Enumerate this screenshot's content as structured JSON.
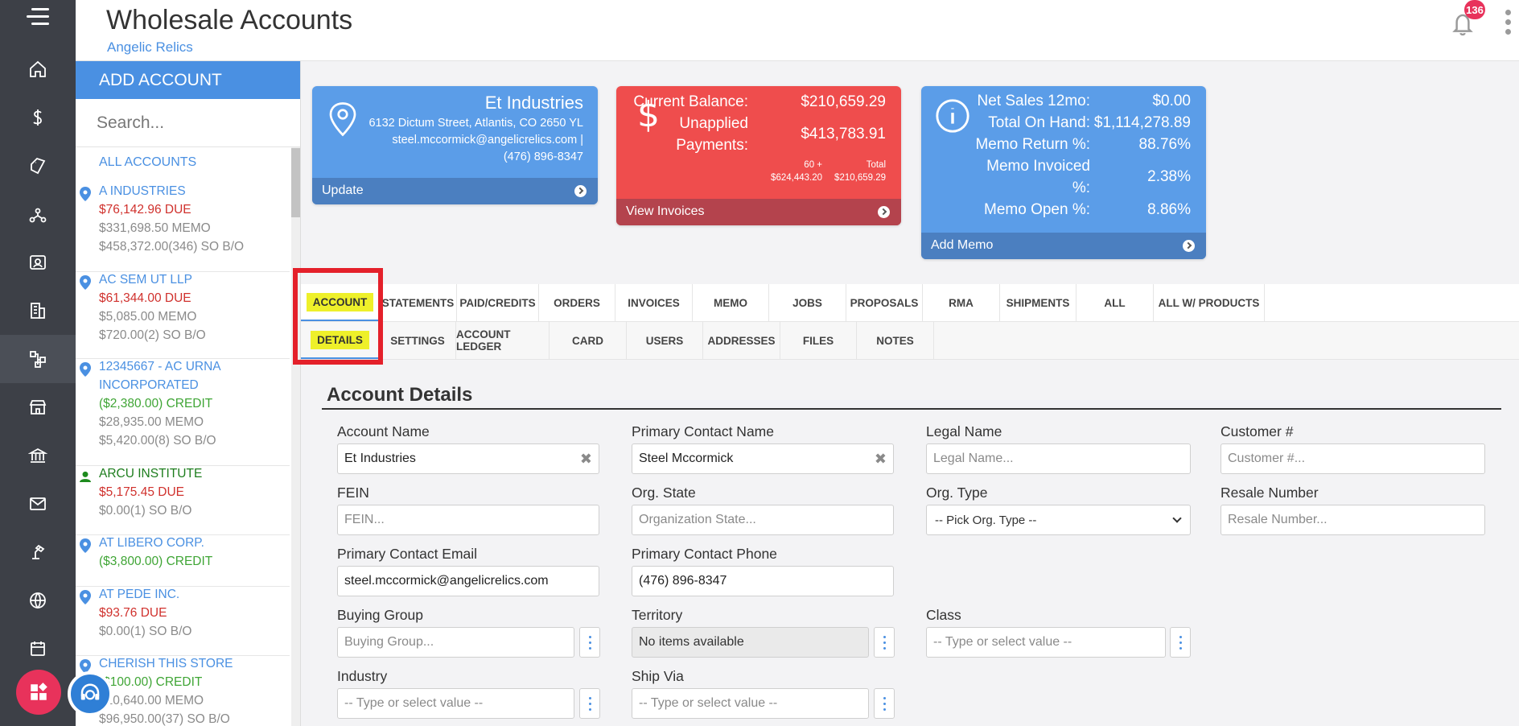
{
  "header": {
    "title": "Wholesale Accounts",
    "subtitle": "Angelic Relics",
    "notification_count": "136"
  },
  "rail": {
    "items": [
      "home-icon",
      "dollar-icon",
      "tags-icon",
      "network-icon",
      "contact-card-icon",
      "building-icon",
      "workflow-icon",
      "store-icon",
      "bank-icon",
      "mail-icon",
      "lamp-icon",
      "globe-icon",
      "calendar-icon"
    ]
  },
  "sidebar": {
    "add_label": "ADD ACCOUNT",
    "search_placeholder": "Search...",
    "all_label": "ALL ACCOUNTS",
    "accounts": [
      {
        "name": "A INDUSTRIES",
        "lines": [
          "$76,142.96 DUE",
          "$331,698.50 MEMO",
          "$458,372.00(346) SO B/O"
        ]
      },
      {
        "name": "AC SEM UT LLP",
        "lines": [
          "$61,344.00 DUE",
          "$5,085.00 MEMO",
          "$720.00(2) SO B/O"
        ]
      },
      {
        "name": "12345667 - AC URNA",
        "name2": "INCORPORATED",
        "lines": [
          "($2,380.00) CREDIT",
          "$28,935.00 MEMO",
          "$5,420.00(8) SO B/O"
        ]
      },
      {
        "name": "ARCU INSTITUTE",
        "lines": [
          "$5,175.45 DUE",
          "$0.00(1) SO B/O"
        ]
      },
      {
        "name": "AT LIBERO CORP.",
        "lines": [
          "($3,800.00) CREDIT"
        ]
      },
      {
        "name": "AT PEDE INC.",
        "lines": [
          "$93.76 DUE",
          "$0.00(1) SO B/O"
        ]
      },
      {
        "name": "CHERISH THIS STORE",
        "lines": [
          "($100.00) CREDIT",
          "$10,640.00 MEMO",
          "$96,950.00(37) SO B/O"
        ]
      }
    ]
  },
  "cards": {
    "company": {
      "name": "Et Industries",
      "address": "6132 Dictum Street, Atlantis, CO 2650 YL",
      "email": "steel.mccormick@angelicrelics.com |",
      "phone": "(476) 896-8347",
      "footer": "Update"
    },
    "balance": {
      "current_label": "Current Balance:",
      "current_value": "$210,659.29",
      "unapplied_label1": "Unapplied",
      "unapplied_label2": "Payments:",
      "unapplied_value": "$413,783.91",
      "aging_label": "60 +",
      "aging_value": "$624,443.20",
      "total_label": "Total",
      "total_value": "$210,659.29",
      "footer": "View Invoices"
    },
    "memo": {
      "rows": [
        {
          "label": "Net Sales 12mo:",
          "value": "$0.00"
        },
        {
          "label": "Total On Hand:",
          "value": "$1,114,278.89"
        },
        {
          "label": "Memo Return %:",
          "value": "88.76%"
        },
        {
          "label": "Memo Invoiced",
          "label2": "%:",
          "value": "2.38%"
        },
        {
          "label": "Memo Open %:",
          "value": "8.86%"
        }
      ],
      "footer": "Add Memo"
    }
  },
  "tabs_primary": [
    "ACCOUNT",
    "STATEMENTS",
    "PAID/CREDITS",
    "ORDERS",
    "INVOICES",
    "MEMO",
    "JOBS",
    "PROPOSALS",
    "RMA",
    "SHIPMENTS",
    "ALL",
    "ALL W/ PRODUCTS"
  ],
  "tabs_secondary": [
    "DETAILS",
    "SETTINGS",
    "ACCOUNT LEDGER",
    "CARD",
    "USERS",
    "ADDRESSES",
    "FILES",
    "NOTES"
  ],
  "form": {
    "section_title": "Account Details",
    "account_name": {
      "label": "Account Name",
      "value": "Et Industries"
    },
    "primary_contact_name": {
      "label": "Primary Contact Name",
      "value": "Steel Mccormick"
    },
    "legal_name": {
      "label": "Legal Name",
      "placeholder": "Legal Name..."
    },
    "customer_no": {
      "label": "Customer #",
      "placeholder": "Customer #..."
    },
    "fein": {
      "label": "FEIN",
      "placeholder": "FEIN..."
    },
    "org_state": {
      "label": "Org. State",
      "placeholder": "Organization State..."
    },
    "org_type": {
      "label": "Org. Type",
      "selected": "-- Pick Org. Type --"
    },
    "resale_number": {
      "label": "Resale Number",
      "placeholder": "Resale Number..."
    },
    "primary_contact_email": {
      "label": "Primary Contact Email",
      "value": "steel.mccormick@angelicrelics.com"
    },
    "primary_contact_phone": {
      "label": "Primary Contact Phone",
      "value": "(476) 896-8347"
    },
    "buying_group": {
      "label": "Buying Group",
      "placeholder": "Buying Group..."
    },
    "territory": {
      "label": "Territory",
      "value": "No items available"
    },
    "class": {
      "label": "Class",
      "placeholder": "-- Type or select value --"
    },
    "industry": {
      "label": "Industry",
      "placeholder": "-- Type or select value --"
    },
    "ship_via": {
      "label": "Ship Via",
      "placeholder": "-- Type or select value --"
    }
  },
  "colors": {
    "accent": "#4a90e2",
    "danger": "#ef4d4d",
    "rail": "#3d4047",
    "highlight": "#eef02a"
  }
}
